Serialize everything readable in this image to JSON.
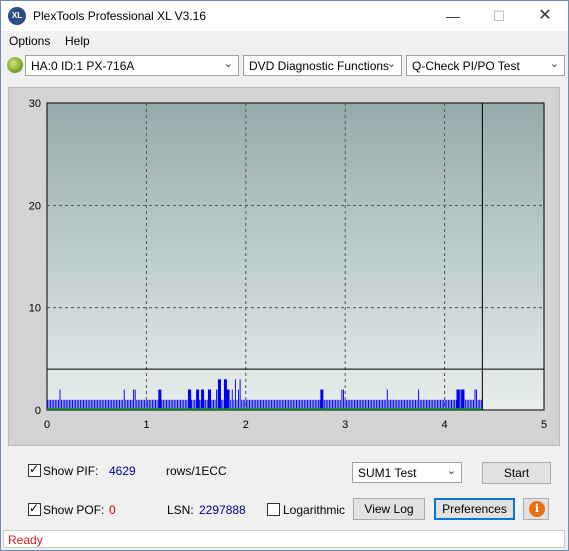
{
  "window": {
    "title": "PlexTools Professional XL V3.16",
    "icon_text": "XL"
  },
  "menu": {
    "options": "Options",
    "help": "Help"
  },
  "toolbar": {
    "drive": "HA:0 ID:1  PX-716A",
    "function": "DVD Diagnostic Functions",
    "test": "Q-Check PI/PO Test"
  },
  "chart_data": {
    "type": "bar",
    "x_ticks": [
      "0",
      "1",
      "2",
      "3",
      "4",
      "5"
    ],
    "y_ticks": [
      "0",
      "10",
      "20",
      "30"
    ],
    "xlim": [
      0,
      5
    ],
    "ylim": [
      0,
      30
    ],
    "grid": true,
    "threshold_line": 4,
    "marker_x": 4.38,
    "colors": {
      "bg_top": "#95abab",
      "bg_bottom": "#e8eeee",
      "bars": "#0000ee",
      "po": "#00aa00"
    },
    "series": [
      {
        "values": [
          1,
          1,
          1,
          1,
          1,
          1,
          1,
          1,
          2,
          1,
          1,
          1,
          1,
          1,
          1,
          1,
          1,
          1,
          1,
          1,
          1,
          1,
          1,
          1,
          1,
          1,
          1,
          1,
          1,
          1,
          1,
          1,
          1,
          1,
          1,
          1,
          1,
          1,
          1,
          1,
          1,
          1,
          1,
          1,
          1,
          1,
          1,
          1,
          1,
          2,
          1,
          1,
          1,
          1,
          1,
          2,
          2,
          1,
          1,
          1,
          1,
          1,
          1,
          1,
          1,
          1,
          1,
          1,
          1,
          1,
          1,
          1,
          1,
          1,
          1,
          1,
          1,
          1,
          1,
          1,
          1,
          1,
          1,
          1,
          1,
          1,
          1,
          1,
          1,
          1,
          2,
          1,
          1,
          1,
          1,
          1,
          1,
          1,
          1,
          1,
          1,
          1,
          1,
          2,
          1,
          1,
          1,
          1,
          2,
          2,
          1,
          1,
          1,
          1,
          1,
          1,
          2,
          1,
          2,
          1,
          3,
          1,
          2,
          3,
          1,
          1,
          1,
          1,
          1,
          1,
          1,
          1,
          1,
          1,
          1,
          1,
          1,
          1,
          1,
          1,
          1,
          1,
          1,
          1,
          1,
          1,
          1,
          1,
          1,
          1,
          1,
          1,
          1,
          1,
          1,
          1,
          1,
          1,
          1,
          1,
          1,
          1,
          1,
          1,
          1,
          1,
          1,
          1,
          1,
          1,
          1,
          1,
          1,
          1,
          1,
          1,
          1,
          1,
          1,
          1,
          1,
          1,
          1,
          1,
          1,
          1,
          1,
          1,
          2,
          2,
          1,
          1,
          1,
          1,
          1,
          1,
          1,
          1,
          1,
          1,
          1,
          1,
          1,
          1,
          1,
          1,
          1,
          1,
          1,
          1,
          1,
          1,
          1,
          1,
          1,
          1,
          1,
          2,
          1,
          1,
          1,
          1,
          1,
          1,
          1,
          1,
          1,
          1,
          1,
          1,
          1,
          1,
          1,
          1,
          1,
          1,
          1,
          2,
          1,
          1,
          1,
          1,
          1,
          1,
          1,
          1,
          1,
          1,
          1,
          1,
          1,
          1,
          1,
          1,
          1,
          1,
          1,
          1,
          1,
          1,
          1,
          1,
          2,
          2,
          2,
          1,
          1,
          1,
          1,
          1,
          1,
          1,
          1,
          2,
          2,
          1,
          1,
          1
        ]
      }
    ]
  },
  "controls": {
    "show_pif_label": "Show PIF:",
    "pif_value": "4629",
    "pif_unit": "rows/1ECC",
    "show_pof_label": "Show POF:",
    "pof_value": "0",
    "lsn_label": "LSN:",
    "lsn_value": "2297888",
    "logarithmic_label": "Logarithmic",
    "sum_select": "SUM1 Test",
    "start": "Start",
    "view_log": "View Log",
    "preferences": "Preferences",
    "info": "i"
  },
  "status": {
    "text": "Ready"
  }
}
